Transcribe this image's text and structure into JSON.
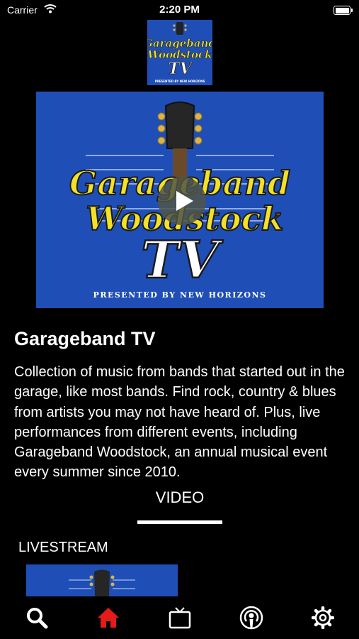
{
  "status_bar": {
    "carrier": "Carrier",
    "time": "2:20 PM"
  },
  "logo": {
    "line1": "Garageband",
    "line2": "Woodstock",
    "line3": "TV",
    "tagline": "PRESENTED BY NEW HORIZONS"
  },
  "channel": {
    "title": "Garageband TV",
    "description": "Collection of music from bands that started out in the garage, like most bands. Find rock, country & blues from artists you may not have heard of. Plus, live performances from different events, including Garageband Woodstock, an annual musical event every summer since 2010."
  },
  "tabs": {
    "active_label": "VIDEO"
  },
  "sections": [
    {
      "label": "LIVESTREAM"
    }
  ],
  "bottom_nav": [
    {
      "icon": "search-icon"
    },
    {
      "icon": "home-icon",
      "active": true
    },
    {
      "icon": "tv-icon"
    },
    {
      "icon": "podcast-icon"
    },
    {
      "icon": "gear-icon"
    }
  ],
  "colors": {
    "art_blue": "#1f4fb6",
    "logo_yellow": "#f2e02a",
    "active_nav": "#e31b1b"
  }
}
